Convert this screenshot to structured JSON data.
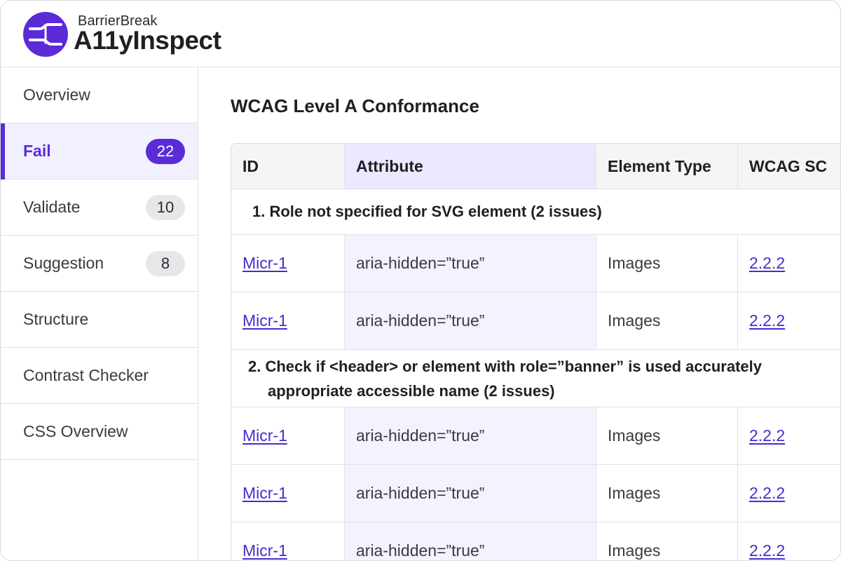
{
  "brand": {
    "company": "BarrierBreak",
    "product": "A11yInspect",
    "logo_icon": "barrierbreak-logo-icon",
    "accent": "#5b2bd8"
  },
  "sidebar": {
    "items": [
      {
        "label": "Overview",
        "badge": ""
      },
      {
        "label": "Fail",
        "badge": "22",
        "active": true
      },
      {
        "label": "Validate",
        "badge": "10"
      },
      {
        "label": "Suggestion",
        "badge": "8"
      },
      {
        "label": "Structure",
        "badge": ""
      },
      {
        "label": "Contrast Checker",
        "badge": ""
      },
      {
        "label": "CSS Overview",
        "badge": ""
      }
    ]
  },
  "main": {
    "title": "WCAG Level A Conformance",
    "table": {
      "headers": {
        "id": "ID",
        "attribute": "Attribute",
        "element_type": "Element Type",
        "wcag_sc": "WCAG SC"
      },
      "groups": [
        {
          "title": "1. Role not specified for SVG element (2 issues)",
          "rows": [
            {
              "id": "Micr-1",
              "attribute": "aria-hidden=”true”",
              "element_type": "Images",
              "wcag_sc": "2.2.2"
            },
            {
              "id": "Micr-1",
              "attribute": "aria-hidden=”true”",
              "element_type": "Images",
              "wcag_sc": "2.2.2"
            }
          ]
        },
        {
          "title_line1": "2. Check if <header> or element with role=”banner” is used accurately",
          "title_line2": "appropriate accessible name (2 issues)",
          "rows": [
            {
              "id": "Micr-1",
              "attribute": "aria-hidden=”true”",
              "element_type": "Images",
              "wcag_sc": "2.2.2"
            },
            {
              "id": "Micr-1",
              "attribute": "aria-hidden=”true”",
              "element_type": "Images",
              "wcag_sc": "2.2.2"
            },
            {
              "id": "Micr-1",
              "attribute": "aria-hidden=”true”",
              "element_type": "Images",
              "wcag_sc": "2.2.2"
            }
          ]
        }
      ]
    }
  }
}
